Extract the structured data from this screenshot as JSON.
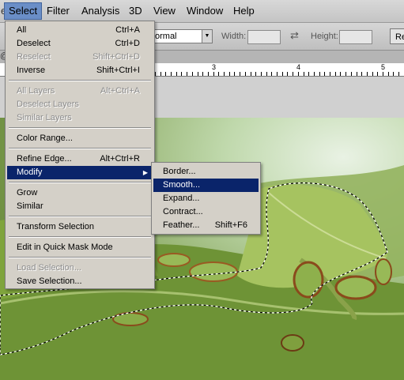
{
  "menubar": {
    "items": [
      "Select",
      "Filter",
      "Analysis",
      "3D",
      "View",
      "Window",
      "Help"
    ],
    "left_fragment": "ea"
  },
  "options": {
    "style_value": "ormal",
    "width_label": "Width:",
    "height_label": "Height:",
    "refine_button": "Re"
  },
  "tabstrip": {
    "fragment": "@"
  },
  "ruler": {
    "labels": [
      "3",
      "4",
      "5"
    ]
  },
  "select_menu": {
    "items": [
      {
        "label": "All",
        "shortcut": "Ctrl+A",
        "enabled": true
      },
      {
        "label": "Deselect",
        "shortcut": "Ctrl+D",
        "enabled": true
      },
      {
        "label": "Reselect",
        "shortcut": "Shift+Ctrl+D",
        "enabled": false
      },
      {
        "label": "Inverse",
        "shortcut": "Shift+Ctrl+I",
        "enabled": true
      },
      {
        "label": "All Layers",
        "shortcut": "Alt+Ctrl+A",
        "enabled": false
      },
      {
        "label": "Deselect Layers",
        "shortcut": "",
        "enabled": false
      },
      {
        "label": "Similar Layers",
        "shortcut": "",
        "enabled": false
      },
      {
        "label": "Color Range...",
        "shortcut": "",
        "enabled": true
      },
      {
        "label": "Refine Edge...",
        "shortcut": "Alt+Ctrl+R",
        "enabled": true
      },
      {
        "label": "Modify",
        "shortcut": "",
        "enabled": true,
        "highlighted": true
      },
      {
        "label": "Grow",
        "shortcut": "",
        "enabled": true
      },
      {
        "label": "Similar",
        "shortcut": "",
        "enabled": true
      },
      {
        "label": "Transform Selection",
        "shortcut": "",
        "enabled": true
      },
      {
        "label": "Edit in Quick Mask Mode",
        "shortcut": "",
        "enabled": true
      },
      {
        "label": "Load Selection...",
        "shortcut": "",
        "enabled": false
      },
      {
        "label": "Save Selection...",
        "shortcut": "",
        "enabled": true
      }
    ]
  },
  "modify_menu": {
    "items": [
      {
        "label": "Border...",
        "shortcut": ""
      },
      {
        "label": "Smooth...",
        "shortcut": "",
        "highlighted": true
      },
      {
        "label": "Expand...",
        "shortcut": ""
      },
      {
        "label": "Contract...",
        "shortcut": ""
      },
      {
        "label": "Feather...",
        "shortcut": "Shift+F6"
      }
    ]
  },
  "colors": {
    "menu_bg": "#d4d0c8",
    "highlight": "#0a246a",
    "active_menu": "#6a8ec7",
    "disabled_text": "#8c8c8c"
  }
}
